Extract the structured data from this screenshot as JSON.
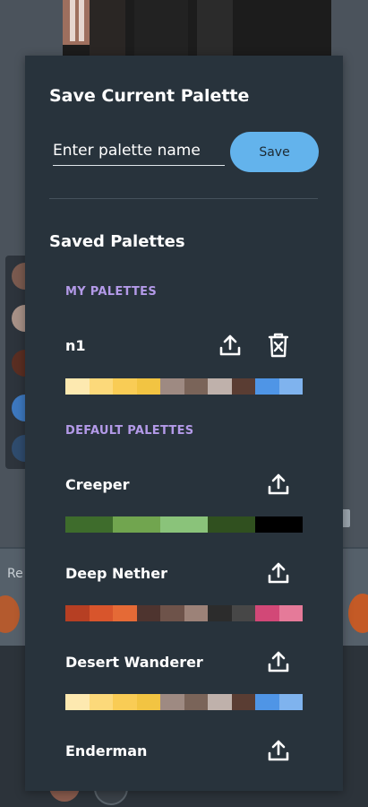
{
  "dialog": {
    "save_title": "Save Current Palette",
    "name_placeholder": "Enter palette name",
    "name_value": "",
    "save_label": "Save",
    "saved_title": "Saved Palettes"
  },
  "sections": {
    "my_palettes": "MY PALETTES",
    "default_palettes": "DEFAULT PALETTES"
  },
  "my_palettes": [
    {
      "name": "n1",
      "colors": [
        "#fde9b0",
        "#fcd97a",
        "#f9cc55",
        "#f2c442",
        "#9e8a82",
        "#7a6459",
        "#bfb1ab",
        "#5a3d33",
        "#4f95e6",
        "#7fb3ee"
      ]
    }
  ],
  "default_palettes": [
    {
      "name": "Creeper",
      "colors": [
        "#3e6c2c",
        "#71a54f",
        "#8ac37a",
        "#30501f",
        "#000000"
      ]
    },
    {
      "name": "Deep Nether",
      "colors": [
        "#b63f23",
        "#d8552c",
        "#e56a36",
        "#4e342f",
        "#6e534a",
        "#9c8278",
        "#2c2c2c",
        "#474747",
        "#d24877",
        "#e57a99"
      ]
    },
    {
      "name": "Desert Wanderer",
      "colors": [
        "#fde9b0",
        "#fcd97a",
        "#f9cc55",
        "#f2c442",
        "#9e8a82",
        "#7a6459",
        "#bfb1ab",
        "#5a3d33",
        "#4f95e6",
        "#7fb3ee"
      ]
    },
    {
      "name": "Enderman",
      "colors": []
    }
  ],
  "background": {
    "card_label": "Re"
  },
  "icons": {
    "upload": "upload-icon",
    "delete": "delete-icon"
  }
}
